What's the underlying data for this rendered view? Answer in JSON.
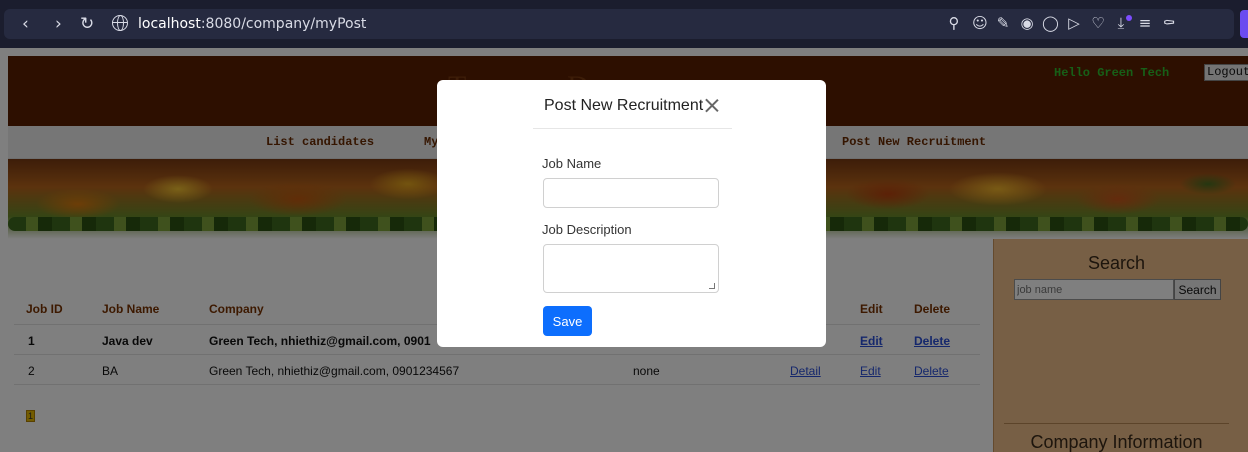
{
  "browser": {
    "url_host": "localhost",
    "url_path": ":8080/company/myPost"
  },
  "header": {
    "title": "Tuyen Dung",
    "greeting": "Hello Green Tech",
    "logout_label": "Logout"
  },
  "menu": {
    "items": [
      {
        "label": "List candidates"
      },
      {
        "label": "My"
      },
      {
        "label": "Post New Recruitment"
      }
    ]
  },
  "table": {
    "headers": [
      "Job ID",
      "Job Name",
      "Company",
      "Edit",
      "Delete"
    ],
    "rows": [
      {
        "id": "1",
        "name": "Java dev",
        "company": "Green Tech, nhiethiz@gmail.com, 0901",
        "status": "",
        "detail": "",
        "edit": "Edit",
        "delete": "Delete"
      },
      {
        "id": "2",
        "name": "BA",
        "company": "Green Tech, nhiethiz@gmail.com, 0901234567",
        "status": "none",
        "detail": "Detail",
        "edit": "Edit",
        "delete": "Delete"
      }
    ],
    "pager": {
      "current": "1"
    }
  },
  "sidebar": {
    "search_title": "Search",
    "search_placeholder": "job name",
    "search_button": "Search",
    "company_title": "Company Information"
  },
  "modal": {
    "title": "Post New Recruitment",
    "job_name_label": "Job Name",
    "job_name_value": "",
    "job_desc_label": "Job Description",
    "job_desc_value": "",
    "save_label": "Save"
  },
  "colors": {
    "header_bg": "#5a1e00",
    "menu_text": "#6a2a00",
    "greeting": "#2fbf2f",
    "primary_button": "#0d6efd",
    "sidebar_bg": "#eebf8a"
  }
}
